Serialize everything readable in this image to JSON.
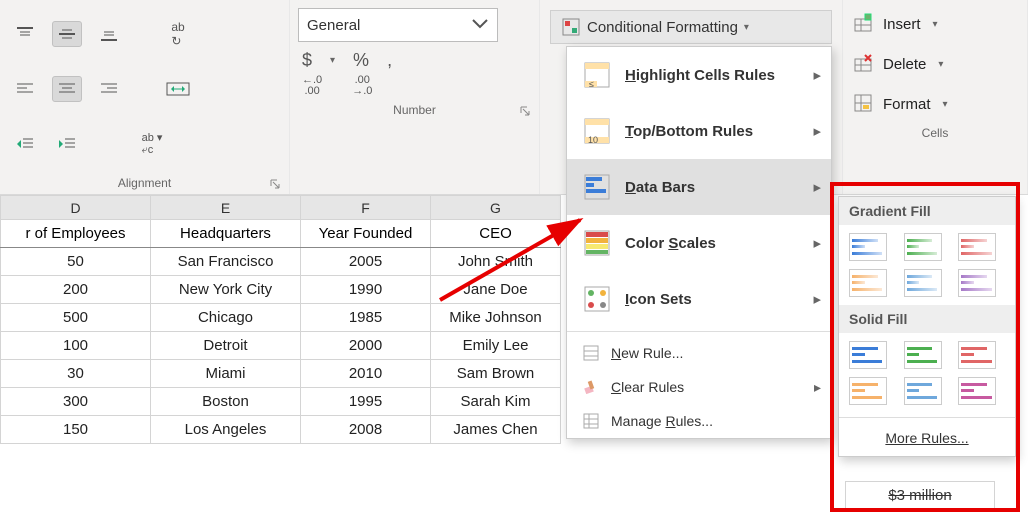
{
  "ribbon": {
    "alignment_label": "Alignment",
    "number_label": "Number",
    "cells_label": "Cells",
    "number_format": "General",
    "currency_symbol": "$",
    "percent_symbol": "%",
    "comma_symbol": ",",
    "dec_inc_top": "←.0",
    "dec_inc_bot": ".00",
    "dec_dec_top": ".00",
    "dec_dec_bot": "→.0",
    "conditional_formatting_label": "Conditional Formatting",
    "insert_label": "Insert",
    "delete_label": "Delete",
    "format_label": "Format"
  },
  "cf_menu": {
    "highlight": "Highlight Cells Rules",
    "topbottom": "Top/Bottom Rules",
    "databars": "Data Bars",
    "colorscales": "Color Scales",
    "iconsets": "Icon Sets",
    "newrule": "New Rule...",
    "clearrules": "Clear Rules",
    "managerules": "Manage Rules..."
  },
  "submenu": {
    "gradient_header": "Gradient Fill",
    "solid_header": "Solid Fill",
    "more_rules": "More Rules..."
  },
  "columns": {
    "D": "D",
    "E": "E",
    "F": "F",
    "G": "G",
    "hdr_D": "r of Employees",
    "hdr_E": "Headquarters",
    "hdr_F": "Year Founded",
    "hdr_G": "CEO"
  },
  "rows": [
    {
      "d": "50",
      "e": "San Francisco",
      "f": "2005",
      "g": "John Smith"
    },
    {
      "d": "200",
      "e": "New York City",
      "f": "1990",
      "g": "Jane Doe"
    },
    {
      "d": "500",
      "e": "Chicago",
      "f": "1985",
      "g": "Mike Johnson"
    },
    {
      "d": "100",
      "e": "Detroit",
      "f": "2000",
      "g": "Emily Lee"
    },
    {
      "d": "30",
      "e": "Miami",
      "f": "2010",
      "g": "Sam Brown"
    },
    {
      "d": "300",
      "e": "Boston",
      "f": "1995",
      "g": "Sarah Kim"
    },
    {
      "d": "150",
      "e": "Los Angeles",
      "f": "2008",
      "g": "James Chen"
    }
  ],
  "peek_cell": "$3 million"
}
